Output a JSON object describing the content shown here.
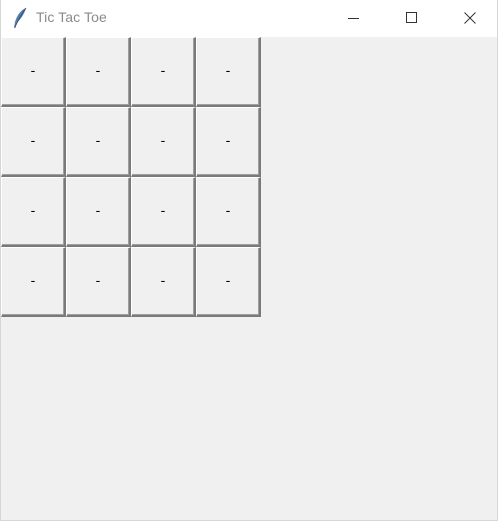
{
  "window": {
    "title": "Tic Tac Toe",
    "app_icon": "feather-icon",
    "controls": [
      "minimize-icon",
      "maximize-icon",
      "close-icon"
    ]
  },
  "board": {
    "rows": 4,
    "cols": 4,
    "cells": [
      [
        "-",
        "-",
        "-",
        "-"
      ],
      [
        "-",
        "-",
        "-",
        "-"
      ],
      [
        "-",
        "-",
        "-",
        "-"
      ],
      [
        "-",
        "-",
        "-",
        "-"
      ]
    ]
  },
  "colors": {
    "background": "#f0f0f0",
    "titlebar": "#ffffff",
    "title_text": "#8a8a8a"
  }
}
